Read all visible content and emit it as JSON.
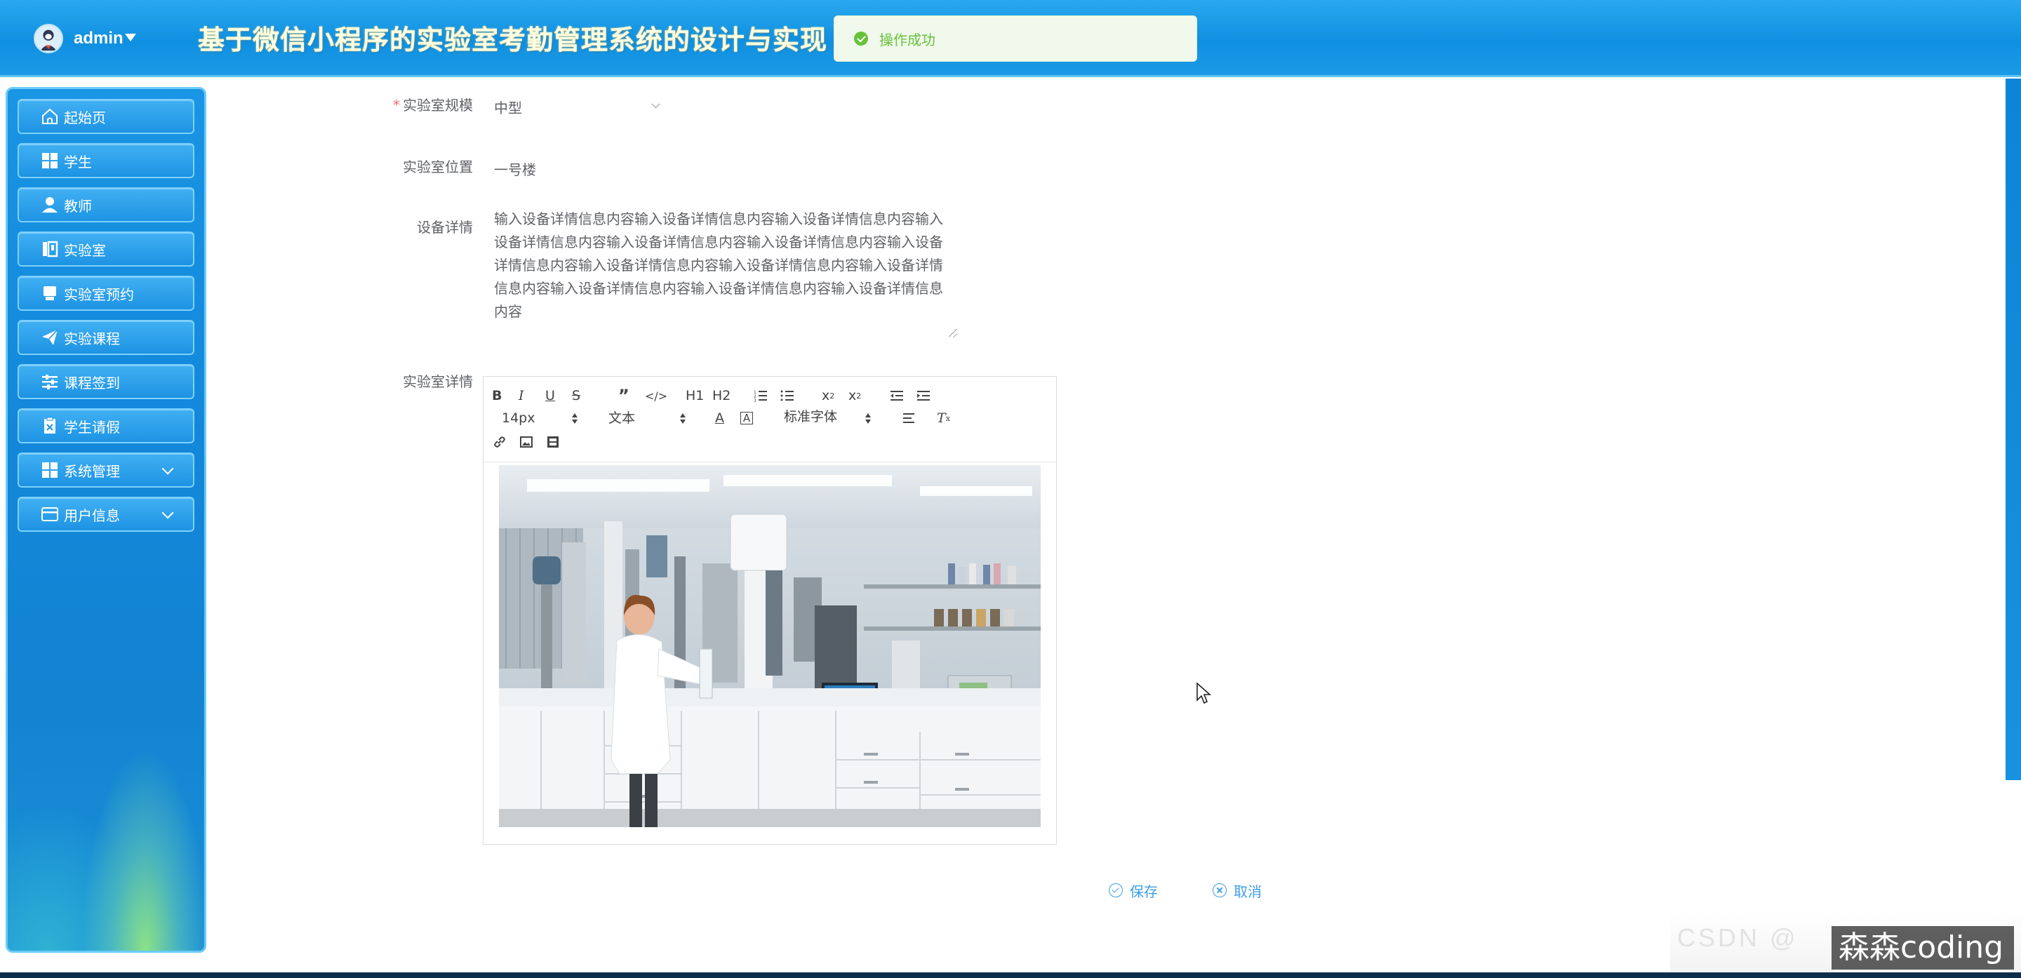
{
  "header": {
    "username": "admin",
    "app_title": "基于微信小程序的实验室考勤管理系统的设计与实现",
    "toast": "操作成功"
  },
  "sidebar": {
    "items": [
      {
        "label": "起始页",
        "icon": "home-icon"
      },
      {
        "label": "学生",
        "icon": "grid-icon"
      },
      {
        "label": "教师",
        "icon": "user-icon"
      },
      {
        "label": "实验室",
        "icon": "book-icon"
      },
      {
        "label": "实验室预约",
        "icon": "printer-icon"
      },
      {
        "label": "实验课程",
        "icon": "paper-plane-icon"
      },
      {
        "label": "课程签到",
        "icon": "sliders-icon"
      },
      {
        "label": "学生请假",
        "icon": "clipboard-icon"
      },
      {
        "label": "系统管理",
        "icon": "grid-icon",
        "expandable": true
      },
      {
        "label": "用户信息",
        "icon": "card-icon",
        "expandable": true
      }
    ]
  },
  "form": {
    "scale_label": "实验室规模",
    "scale_value": "中型",
    "location_label": "实验室位置",
    "location_value": "一号楼",
    "equipment_label": "设备详情",
    "equipment_value": "输入设备详情信息内容输入设备详情信息内容输入设备详情信息内容输入设备详情信息内容输入设备详情信息内容输入设备详情信息内容输入设备详情信息内容输入设备详情信息内容输入设备详情信息内容输入设备详情信息内容输入设备详情信息内容输入设备详情信息内容输入设备详情信息内容",
    "detail_label": "实验室详情",
    "editor": {
      "font_size": "14px",
      "header_select": "文本",
      "font_family": "标准字体",
      "h1": "H1",
      "h2": "H2"
    },
    "save_label": "保存",
    "cancel_label": "取消"
  },
  "watermark": {
    "blurred": "CSDN @",
    "text": "森森coding"
  },
  "colors": {
    "header_blue": "#1b9be6",
    "toast_green": "#67c23a",
    "link_blue": "#3d9ee8",
    "required_red": "#f56c6c"
  }
}
